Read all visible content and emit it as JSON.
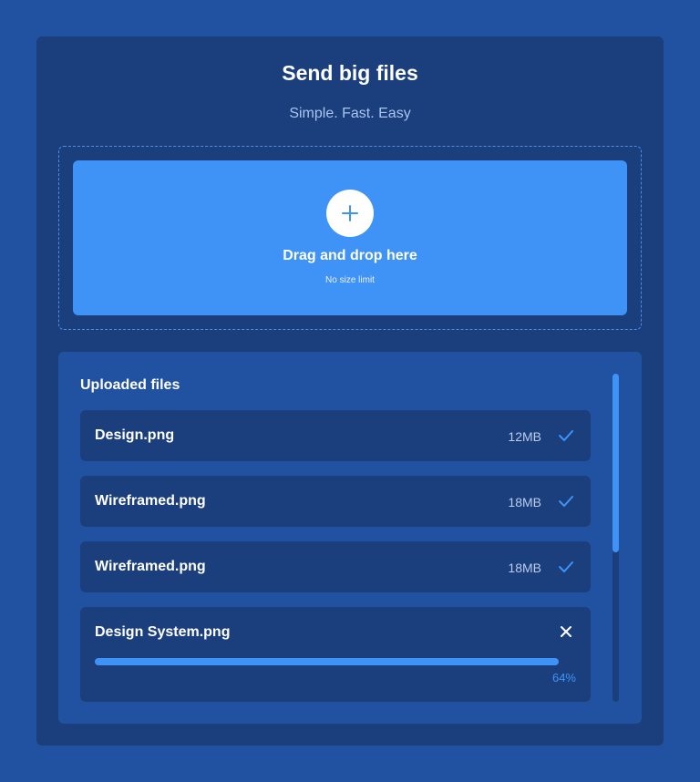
{
  "header": {
    "title": "Send big files",
    "subtitle": "Simple. Fast. Easy"
  },
  "dropzone": {
    "icon": "plus-icon",
    "label": "Drag and drop here",
    "hint": "No size limit"
  },
  "files": {
    "heading": "Uploaded files",
    "completed": [
      {
        "name": "Design.png",
        "size": "12MB",
        "status_icon": "check-icon"
      },
      {
        "name": "Wireframed.png",
        "size": "18MB",
        "status_icon": "check-icon"
      },
      {
        "name": "Wireframed.png",
        "size": "18MB",
        "status_icon": "check-icon"
      }
    ],
    "uploading": {
      "name": "Design System.png",
      "progress_label": "64%",
      "progress": 0.64,
      "action_icon": "close-icon"
    }
  },
  "colors": {
    "background": "#2152a2",
    "card": "#1b3f7d",
    "accent": "#3f93f7",
    "text": "#ffffff"
  }
}
